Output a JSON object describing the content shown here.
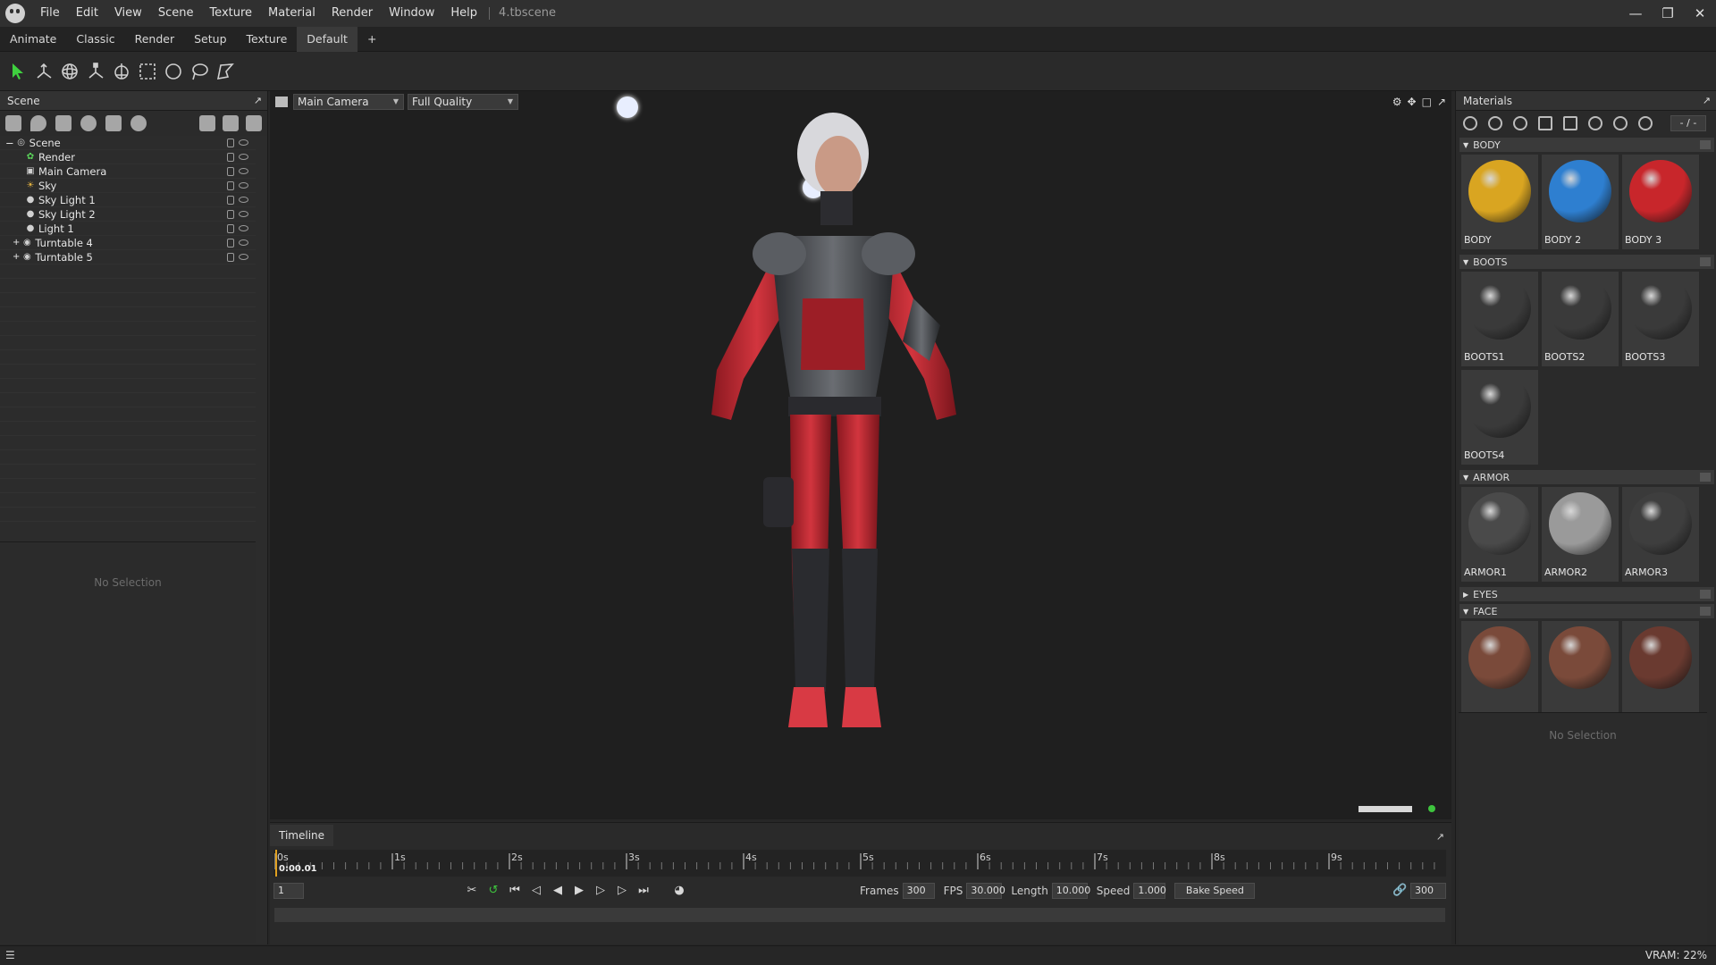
{
  "app": {
    "file_name": "4.tbscene"
  },
  "menu": [
    "File",
    "Edit",
    "View",
    "Scene",
    "Texture",
    "Material",
    "Render",
    "Window",
    "Help"
  ],
  "workspace_tabs": [
    "Animate",
    "Classic",
    "Render",
    "Setup",
    "Texture",
    "Default",
    "+"
  ],
  "active_tab": "Default",
  "tools": [
    "select-icon",
    "transform-icon",
    "rotate-icon",
    "scale-icon",
    "pivot-icon",
    "marquee-select-icon",
    "circle-select-icon",
    "lasso-select-icon",
    "polygon-select-icon"
  ],
  "scene_panel": {
    "title": "Scene",
    "items": [
      {
        "label": "Scene",
        "icon": "scene-icon",
        "depth": 0
      },
      {
        "label": "Render",
        "icon": "render-icon",
        "depth": 1
      },
      {
        "label": "Main Camera",
        "icon": "camera-icon",
        "depth": 1
      },
      {
        "label": "Sky",
        "icon": "sky-icon",
        "depth": 1
      },
      {
        "label": "Sky Light 1",
        "icon": "light-icon",
        "depth": 1
      },
      {
        "label": "Sky Light 2",
        "icon": "light-icon",
        "depth": 1
      },
      {
        "label": "Light 1",
        "icon": "light-icon",
        "depth": 1
      },
      {
        "label": "Turntable 4",
        "icon": "turntable-icon",
        "depth": 1
      },
      {
        "label": "Turntable 5",
        "icon": "turntable-icon",
        "depth": 1
      }
    ],
    "no_selection": "No Selection"
  },
  "viewport": {
    "camera": "Main Camera",
    "quality": "Full Quality"
  },
  "timeline": {
    "title": "Timeline",
    "ticks": [
      "0s",
      "1s",
      "2s",
      "3s",
      "4s",
      "5s",
      "6s",
      "7s",
      "8s",
      "9s"
    ],
    "current_time": "0:00.01",
    "current_frame": "1",
    "frames_label": "Frames",
    "frames": "300",
    "fps_label": "FPS",
    "fps": "30.000",
    "length_label": "Length",
    "length": "10.000",
    "speed_label": "Speed",
    "speed": "1.000",
    "bake_speed": "Bake Speed",
    "end_frame": "300"
  },
  "materials_panel": {
    "title": "Materials",
    "search": "- / -",
    "categories": [
      {
        "name": "BODY",
        "expanded": true,
        "items": [
          {
            "name": "BODY",
            "color": "#d9a521"
          },
          {
            "name": "BODY 2",
            "color": "#2e7fd0"
          },
          {
            "name": "BODY 3",
            "color": "#c8262b"
          }
        ]
      },
      {
        "name": "BOOTS",
        "expanded": true,
        "items": [
          {
            "name": "BOOTS1",
            "color": "#3a3a3a"
          },
          {
            "name": "BOOTS2",
            "color": "#3a3a3a"
          },
          {
            "name": "BOOTS3",
            "color": "#3a3a3a"
          },
          {
            "name": "BOOTS4",
            "color": "#3a3a3a"
          }
        ]
      },
      {
        "name": "ARMOR",
        "expanded": true,
        "items": [
          {
            "name": "ARMOR1",
            "color": "#4a4a4a"
          },
          {
            "name": "ARMOR2",
            "color": "#9a9a9a"
          },
          {
            "name": "ARMOR3",
            "color": "#3e3e3e"
          }
        ]
      },
      {
        "name": "EYES",
        "expanded": false,
        "items": []
      },
      {
        "name": "FACE",
        "expanded": true,
        "items": [
          {
            "name": "",
            "color": "#7a4a3a"
          },
          {
            "name": "",
            "color": "#7a4a3a"
          },
          {
            "name": "",
            "color": "#6a3a30"
          }
        ]
      }
    ],
    "no_selection": "No Selection"
  },
  "status": {
    "vram": "VRAM: 22%"
  }
}
